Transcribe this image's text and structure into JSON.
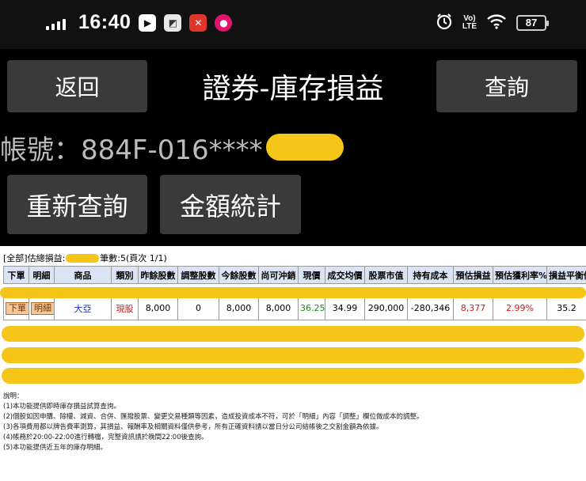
{
  "status_bar": {
    "time": "16:40",
    "volte": "Vo) LTE",
    "battery": "87",
    "icons": [
      "signal-icon",
      "youtube-icon",
      "maps-icon",
      "close-app-icon",
      "panda-icon",
      "alarm-icon",
      "volte-icon",
      "wifi-icon",
      "battery-icon"
    ]
  },
  "header": {
    "back_label": "返回",
    "title": "證券-庫存損益",
    "query_label": "查詢"
  },
  "account": {
    "label": "帳號：884F-016****"
  },
  "actions": {
    "requery_label": "重新查詢",
    "amount_label": "金額統計"
  },
  "summary": {
    "prefix": "[全部]估總損益:",
    "suffix": "筆數:5(頁次 1/1)"
  },
  "table": {
    "columns": [
      "下單",
      "明細",
      "商品",
      "類別",
      "昨餘股數",
      "調整股數",
      "今餘股數",
      "尚可沖銷",
      "現價",
      "成交均價",
      "股票市值",
      "持有成本",
      "預估損益",
      "預估獲利率%",
      "損益平衡價"
    ],
    "row": {
      "order": "下單",
      "detail": "明細",
      "product": "大亞",
      "category": "現股",
      "prev_shares": "8,000",
      "adjust_shares": "0",
      "today_shares": "8,000",
      "offsettable": "8,000",
      "price": "36.25",
      "avg_price": "34.99",
      "market_value": "290,000",
      "cost": "-280,346",
      "est_pl": "8,377",
      "est_rate": "2.99%",
      "breakeven": "35.2"
    }
  },
  "notes": {
    "title": "說明：",
    "lines": [
      "(1)本功能提供即時庫存損益試算查詢。",
      "(2)個股如因申購、除權、減資、合併、匯撥股票、變更交易種類等因素，造成投資成本不符，可於「明細」內容「調整」欄位做成本的調整。",
      "(3)各項費用都以牌告費率測算，其損益、報酬率及相關資料僅供參考，所有正確資料請以當日分公司結帳後之交割金額為依據。",
      "(4)帳務於20:00-22:00進行轉檔，完整資訊請於晚間22:00後查詢。",
      "(5)本功能提供近五年的庫存明細。"
    ]
  },
  "colors": {
    "background": "#000000",
    "button": "#3a3a3a",
    "redaction": "#f5c518",
    "header_row": "#d9e4f5",
    "profit_red": "#c81e1e",
    "price_green": "#1b8a1b",
    "link_blue": "#1a33b3"
  }
}
